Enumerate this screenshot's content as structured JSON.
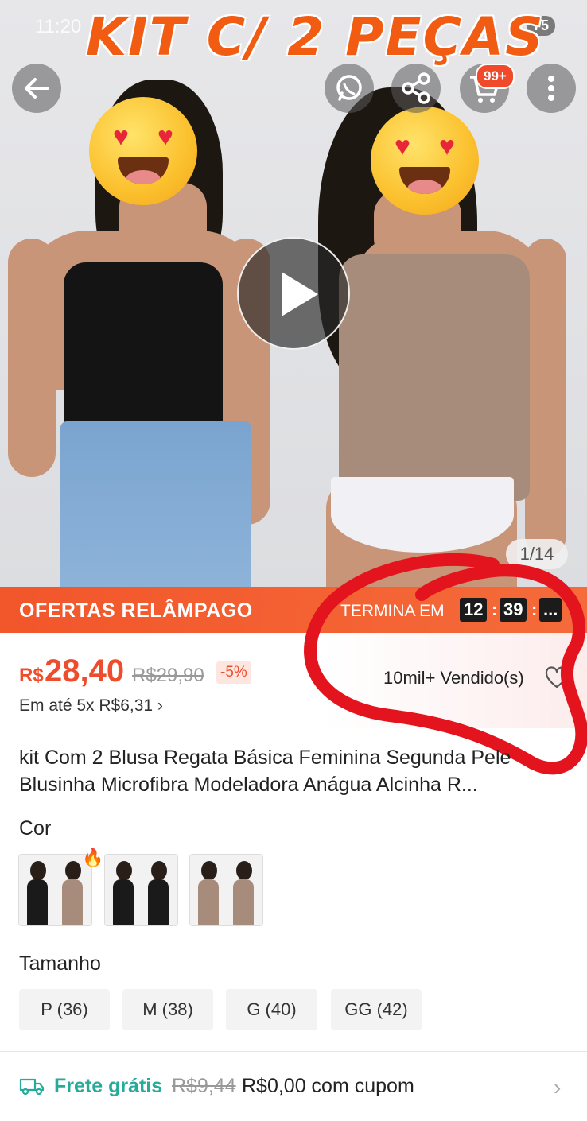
{
  "status": {
    "time": "11:20",
    "battery": "75"
  },
  "overlay_title": "KIT C/ 2 PEÇAS",
  "cart_badge": "99+",
  "image_counter": "1/14",
  "flash": {
    "title": "OFERTAS RELÂMPAGO",
    "ends_label": "TERMINA EM",
    "hours": "12",
    "minutes": "39",
    "seconds": "..."
  },
  "price": {
    "currency": "R$",
    "current": "28,40",
    "original": "R$29,90",
    "discount": "-5%",
    "installments": "Em até 5x R$6,31",
    "sold": "10mil+ Vendido(s)"
  },
  "product_title": "kit Com 2 Blusa Regata Básica Feminina Segunda Pele Blusinha Microfibra Modeladora Anágua Alcinha R...",
  "color_label": "Cor",
  "size_label": "Tamanho",
  "sizes": [
    "P (36)",
    "M (38)",
    "G (40)",
    "GG (42)"
  ],
  "shipping": {
    "free_label": "Frete grátis",
    "old_price": "R$9,44",
    "new_price": "R$0,00 com cupom"
  },
  "colors": {
    "accent": "#ee4d2d",
    "shipping": "#26aa99"
  },
  "icons": [
    "back-icon",
    "whatsapp-icon",
    "share-icon",
    "cart-icon",
    "more-icon",
    "play-icon",
    "heart-icon",
    "truck-icon",
    "chevron-right-icon"
  ]
}
